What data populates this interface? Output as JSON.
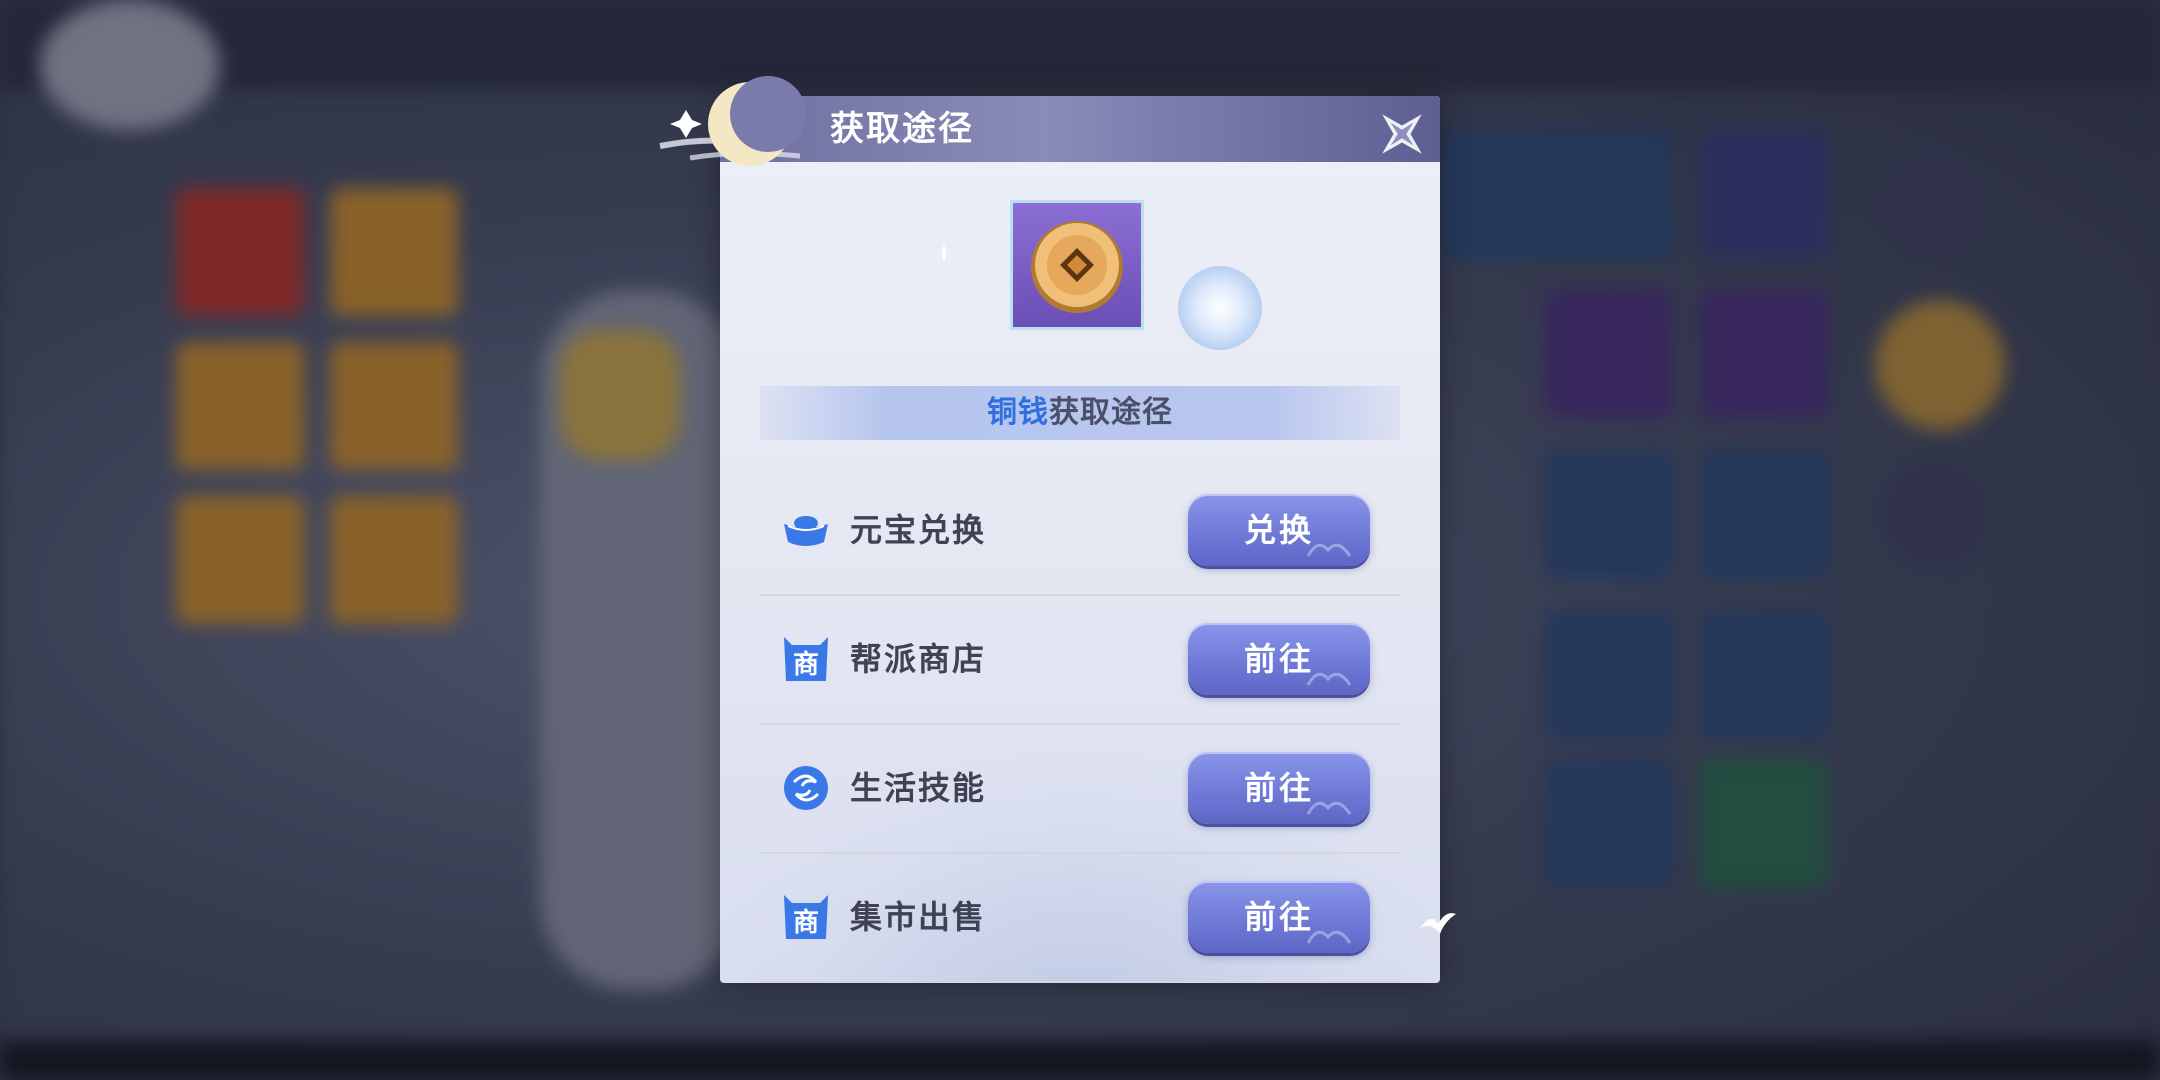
{
  "dialog": {
    "title": "获取途径",
    "item": {
      "name": "铜钱",
      "icon": "copper-coin-icon"
    },
    "section_highlight": "铜钱",
    "section_suffix": "获取途径",
    "close_icon": "close-icon"
  },
  "sources": [
    {
      "icon": "gold-ingot-icon",
      "label": "元宝兑换",
      "button": "兑换"
    },
    {
      "icon": "shop-icon",
      "label": "帮派商店",
      "button": "前往"
    },
    {
      "icon": "swirl-skill-icon",
      "label": "生活技能",
      "button": "前往"
    },
    {
      "icon": "shop-icon",
      "label": "集市出售",
      "button": "前往"
    }
  ],
  "colors": {
    "accent": "#2f6fe0",
    "button": "#6d78d6",
    "title_bar": "#7b7bab",
    "item_background": "#7a5cc6"
  }
}
